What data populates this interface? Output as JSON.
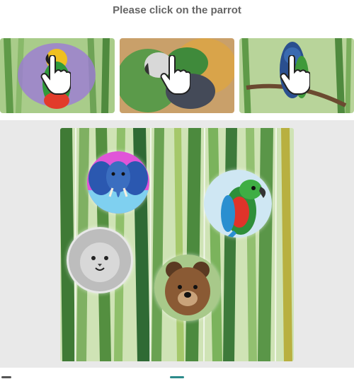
{
  "instruction": "Please click on the parrot",
  "colors": {
    "panel_bg": "#e9e9e9",
    "text": "#666666",
    "grass_dark": "#3f7a35",
    "grass_light": "#8fbf6a"
  },
  "examples": [
    {
      "subject": "parrot",
      "icon": "pointer-hand-icon"
    },
    {
      "subject": "parrot",
      "icon": "pointer-hand-icon"
    },
    {
      "subject": "parrot",
      "icon": "pointer-hand-icon"
    }
  ],
  "board": {
    "background": "bamboo-forest",
    "animals": [
      "elephant",
      "parrot",
      "lion",
      "bear"
    ]
  }
}
